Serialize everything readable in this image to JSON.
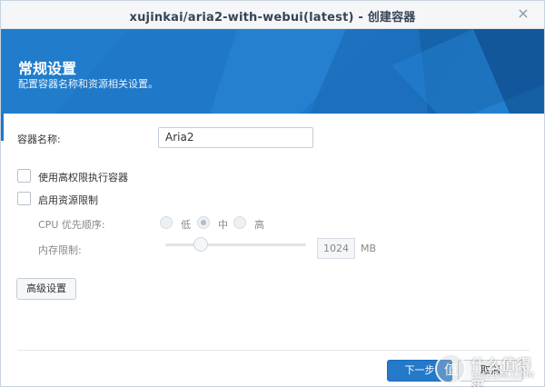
{
  "window": {
    "title": "xujinkai/aria2-with-webui(latest) - 创建容器",
    "close_glyph": "×"
  },
  "banner": {
    "heading": "常规设置",
    "subheading": "配置容器名称和资源相关设置。"
  },
  "form": {
    "container_name_label": "容器名称:",
    "container_name_value": "Aria2",
    "privileged_label": "使用高权限执行容器",
    "privileged_checked": false,
    "resource_limit_label": "启用资源限制",
    "resource_limit_checked": false,
    "cpu_priority_label": "CPU 优先顺序:",
    "cpu_options": [
      "低",
      "中",
      "高"
    ],
    "cpu_selected": "中",
    "memory_limit_label": "内存限制:",
    "memory_value": "1024",
    "memory_unit": "MB",
    "memory_slider_fraction": 0.25
  },
  "buttons": {
    "advanced": "高级设置",
    "next": "下一步",
    "cancel": "取消"
  },
  "watermark": {
    "glyph": "值",
    "line1": "什么值得买",
    "line2": "SMZDM.COM"
  },
  "colors": {
    "accent": "#1f78c8",
    "primary_button": "#2479c8"
  }
}
